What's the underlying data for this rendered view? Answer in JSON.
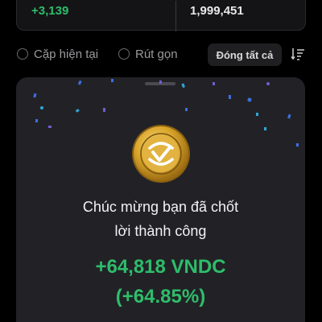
{
  "stats": {
    "pnl": "+3,139",
    "balance": "1,999,451"
  },
  "filters": {
    "current_pair_label": "Cặp hiện tại",
    "compact_label": "Rút gọn",
    "close_all_label": "Đóng tất cả",
    "sort_icon": "sort-icon"
  },
  "celebration": {
    "coin_icon": "vndc-coin-icon",
    "headline_line1": "Chúc mừng bạn đã chốt",
    "headline_line2": "lời thành công",
    "amount": "+64,818 VNDC",
    "percent": "(+64.85%)"
  },
  "colors": {
    "profit_green": "#2ebd6b",
    "panel_bg": "#222226",
    "coin_gold": "#d9a52b"
  }
}
